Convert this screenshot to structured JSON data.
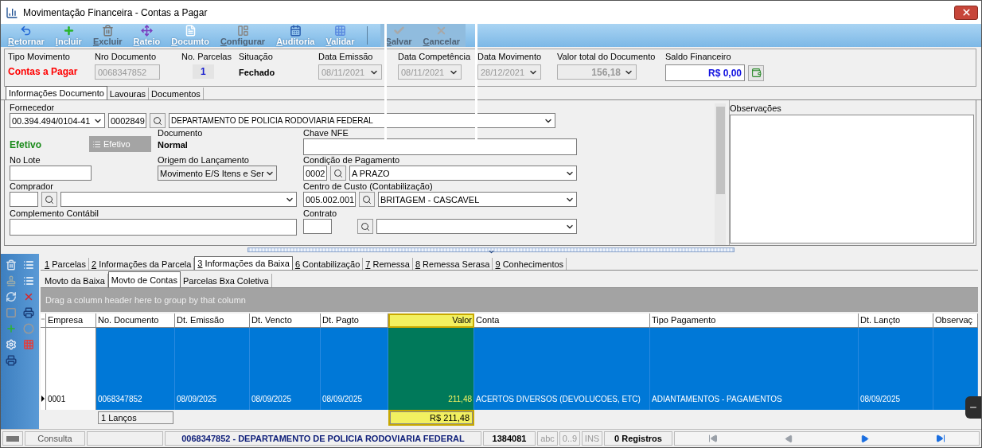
{
  "window": {
    "title": "Movimentação Financeira - Contas a Pagar"
  },
  "toolbar": {
    "main": [
      {
        "label": "Retornar",
        "disabled": false
      },
      {
        "label": "Incluir",
        "disabled": false
      },
      {
        "label": "Excluir",
        "disabled": true
      },
      {
        "label": "Rateio",
        "disabled": false
      },
      {
        "label": "Documto",
        "disabled": false
      },
      {
        "label": "Configurar",
        "disabled": true
      },
      {
        "label": "Auditoria",
        "disabled": false
      },
      {
        "label": "Validar",
        "disabled": false
      }
    ],
    "edit": [
      {
        "label": "Salvar",
        "disabled": true
      },
      {
        "label": "Cancelar",
        "disabled": true
      }
    ]
  },
  "header": {
    "tipo_movimento": {
      "label": "Tipo Movimento",
      "value": "Contas a Pagar"
    },
    "nro_documento": {
      "label": "Nro Documento",
      "value": "0068347852"
    },
    "no_parcelas": {
      "label": "No. Parcelas",
      "value": "1"
    },
    "situacao": {
      "label": "Situação",
      "value": "Fechado"
    },
    "dates": [
      {
        "label": "Data Emissão",
        "value": "08/11/2021"
      },
      {
        "label": "Data Competência",
        "value": "08/11/2021"
      },
      {
        "label": "Data Movimento",
        "value": "28/12/2021"
      }
    ],
    "valor_total": {
      "label": "Valor total do Documento",
      "value": "156,18"
    },
    "saldo": {
      "label": "Saldo Financeiro",
      "value": "R$ 0,00"
    }
  },
  "form_tabs": [
    {
      "label": "Informações Documento",
      "selected": true
    },
    {
      "label": "Lavouras",
      "selected": false
    },
    {
      "label": "Documentos",
      "selected": false
    }
  ],
  "form": {
    "fornecedor": {
      "label": "Fornecedor",
      "cnpj": "00.394.494/0104-41",
      "code": "0002849",
      "name": "DEPARTAMENTO DE POLICIA RODOVIARIA FEDERAL"
    },
    "status": {
      "value": "Efetivo",
      "button": "Efetivo"
    },
    "documento": {
      "label": "Documento",
      "value": "Normal"
    },
    "chave_nfe": {
      "label": "Chave NFE"
    },
    "no_lote": {
      "label": "No Lote"
    },
    "origem": {
      "label": "Origem do Lançamento",
      "value": "Movimento E/S Itens e Ser"
    },
    "condicao": {
      "label": "Condição de Pagamento",
      "code": "0002",
      "name": "A PRAZO"
    },
    "comprador": {
      "label": "Comprador"
    },
    "centro_custo": {
      "label": "Centro de Custo (Contabilização)",
      "code": "005.002.001",
      "name": "BRITAGEM - CASCAVEL"
    },
    "complemento": {
      "label": "Complemento Contábil"
    },
    "contrato": {
      "label": "Contrato"
    },
    "observacoes": {
      "label": "Observações"
    }
  },
  "detail_tabs": [
    {
      "label": "1 Parcelas",
      "selected": false
    },
    {
      "label": "2 Informações da Parcela",
      "selected": false
    },
    {
      "label": "3 Informações da Baixa",
      "selected": true
    },
    {
      "label": "6 Contabilização",
      "selected": false
    },
    {
      "label": "7 Remessa",
      "selected": false
    },
    {
      "label": "8 Remessa Serasa",
      "selected": false
    },
    {
      "label": "9 Conhecimentos",
      "selected": false
    }
  ],
  "sub_tabs": [
    {
      "label": "Movto da Baixa",
      "selected": false
    },
    {
      "label": "Movto de Contas",
      "selected": true
    },
    {
      "label": "Parcelas Bxa Coletiva",
      "selected": false
    }
  ],
  "grid": {
    "group_hint": "Drag a column header here to group by that column",
    "columns": [
      {
        "label": "Empresa",
        "selected": false,
        "kind": "text"
      },
      {
        "label": "No. Documento",
        "selected": false,
        "kind": "text",
        "total": "1 Lanços"
      },
      {
        "label": "Dt. Emissão",
        "selected": false,
        "kind": "text"
      },
      {
        "label": "Dt. Vencto",
        "selected": false,
        "kind": "text"
      },
      {
        "label": "Dt. Pagto",
        "selected": false,
        "kind": "text"
      },
      {
        "label": "Valor",
        "selected": true,
        "kind": "number",
        "total": "R$ 211,48"
      },
      {
        "label": "Conta",
        "selected": false,
        "kind": "text"
      },
      {
        "label": "Tipo Pagamento",
        "selected": false,
        "kind": "text"
      },
      {
        "label": "Dt. Lançto",
        "selected": false,
        "kind": "text"
      },
      {
        "label": "Observaç",
        "selected": false,
        "kind": "text"
      }
    ],
    "rows": [
      {
        "selected": true,
        "cells": [
          "0001",
          "0068347852",
          "08/09/2025",
          "08/09/2025",
          "08/09/2025",
          "211,48",
          "ACERTOS DIVERSOS (DEVOLUCOES, ETC)",
          "ADIANTAMENTOS - PAGAMENTOS",
          "08/09/2025"
        ]
      }
    ]
  },
  "status_bar": {
    "mode": "Consulta",
    "document": "0068347852 - DEPARTAMENTO DE POLICIA RODOVIARIA FEDERAL",
    "code": "1384081",
    "indicators": [
      {
        "label": "abc",
        "on": false
      },
      {
        "label": "0..9",
        "on": false
      },
      {
        "label": "INS",
        "on": false
      }
    ],
    "records": "0 Registros",
    "nav": [
      {
        "kind": "first",
        "disabled": true
      },
      {
        "kind": "prev",
        "disabled": true
      },
      {
        "kind": "next",
        "disabled": false
      },
      {
        "kind": "last",
        "disabled": false
      }
    ]
  }
}
